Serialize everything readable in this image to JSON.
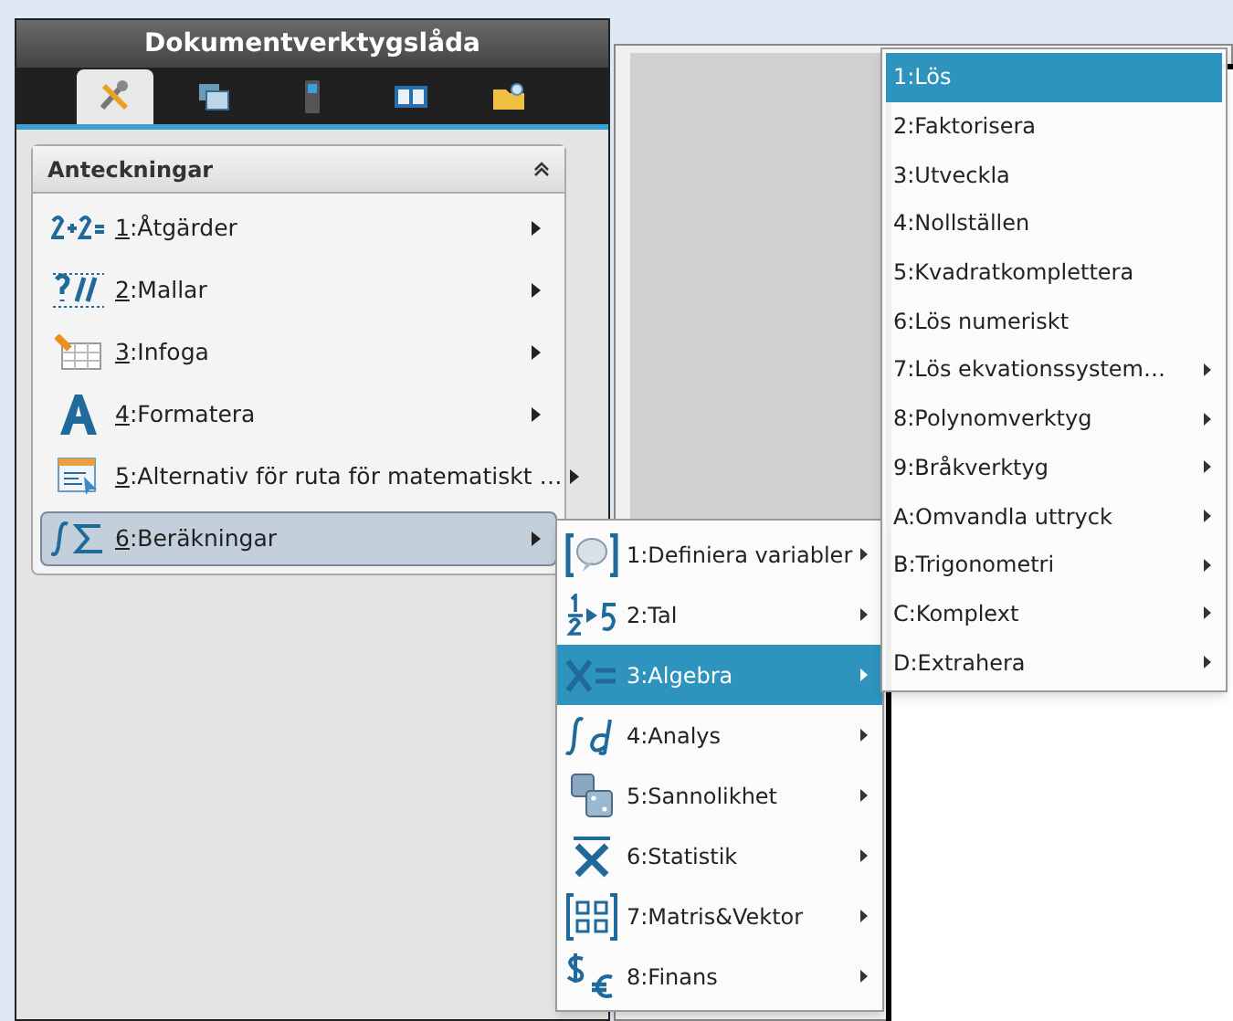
{
  "window": {
    "title": "Dokumentverktygslåda"
  },
  "tabs": [
    {
      "selected": true
    },
    {
      "selected": false
    },
    {
      "selected": false
    },
    {
      "selected": false
    },
    {
      "selected": false
    }
  ],
  "panel": {
    "title": "Anteckningar",
    "expanded": true
  },
  "menu": [
    {
      "key": "1",
      "label": ":Åtgärder",
      "selected": false
    },
    {
      "key": "2",
      "label": ":Mallar",
      "selected": false
    },
    {
      "key": "3",
      "label": ":Infoga",
      "selected": false
    },
    {
      "key": "4",
      "label": ":Formatera",
      "selected": false
    },
    {
      "key": "5",
      "label": ":Alternativ för ruta för matematiskt …",
      "selected": false
    },
    {
      "key": "6",
      "label": ":Beräkningar",
      "selected": true
    }
  ],
  "submenu": [
    {
      "label": "1:Definiera variabler",
      "selected": false
    },
    {
      "label": "2:Tal",
      "selected": false
    },
    {
      "label": "3:Algebra",
      "selected": true
    },
    {
      "label": "4:Analys",
      "selected": false
    },
    {
      "label": "5:Sannolikhet",
      "selected": false
    },
    {
      "label": "6:Statistik",
      "selected": false
    },
    {
      "label": "7:Matris&Vektor",
      "selected": false
    },
    {
      "label": "8:Finans",
      "selected": false
    }
  ],
  "algebra_menu": [
    {
      "label": "1:Lös",
      "selected": true,
      "has_submenu": false
    },
    {
      "label": "2:Faktorisera",
      "selected": false,
      "has_submenu": false
    },
    {
      "label": "3:Utveckla",
      "selected": false,
      "has_submenu": false
    },
    {
      "label": "4:Nollställen",
      "selected": false,
      "has_submenu": false
    },
    {
      "label": "5:Kvadratkomplettera",
      "selected": false,
      "has_submenu": false
    },
    {
      "label": "6:Lös numeriskt",
      "selected": false,
      "has_submenu": false
    },
    {
      "label": "7:Lös ekvationssystem…",
      "selected": false,
      "has_submenu": true
    },
    {
      "label": "8:Polynomverktyg",
      "selected": false,
      "has_submenu": true
    },
    {
      "label": "9:Bråkverktyg",
      "selected": false,
      "has_submenu": true
    },
    {
      "label": "A:Omvandla uttryck",
      "selected": false,
      "has_submenu": true
    },
    {
      "label": "B:Trigonometri",
      "selected": false,
      "has_submenu": true
    },
    {
      "label": "C:Komplext",
      "selected": false,
      "has_submenu": true
    },
    {
      "label": "D:Extrahera",
      "selected": false,
      "has_submenu": true
    }
  ]
}
